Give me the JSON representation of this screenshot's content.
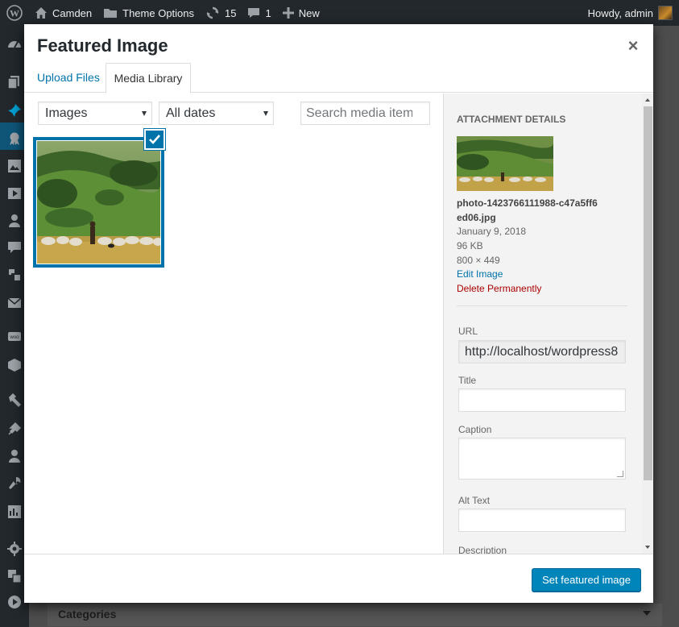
{
  "admin_bar": {
    "site_name": "Camden",
    "theme_options": "Theme Options",
    "updates_count": "15",
    "comments_count": "1",
    "new_label": "New",
    "greeting": "Howdy, admin"
  },
  "admin_menu": {
    "icons": [
      "dashboard-icon",
      "posts-icon",
      "pin-icon",
      "award-icon",
      "media-icon",
      "video-icon",
      "users-icon",
      "comments-icon",
      "tools-icon",
      "email-icon",
      "woo-icon",
      "box-icon",
      "hammer-icon",
      "plugins-icon",
      "person-icon",
      "wrench-icon",
      "grid-icon",
      "gear-icon",
      "translate-icon",
      "play-icon"
    ]
  },
  "modal": {
    "title": "Featured Image",
    "close_symbol": "×",
    "tabs": [
      {
        "label": "Upload Files",
        "active": false
      },
      {
        "label": "Media Library",
        "active": true
      }
    ],
    "filters": {
      "type_selected": "Images",
      "date_selected": "All dates",
      "search_placeholder": "Search media items..."
    },
    "attachments": [
      {
        "alt": "Shepherd with sheep on green hillside",
        "selected": true
      }
    ],
    "details": {
      "heading": "Attachment Details",
      "filename": "photo-1423766111988-c47a5ff6ed06.jpg",
      "date": "January 9, 2018",
      "size": "96 KB",
      "dimensions": "800 × 449",
      "edit_link": "Edit Image",
      "delete_link": "Delete Permanently",
      "fields": {
        "url_label": "URL",
        "url_value": "http://localhost/wordpress8",
        "title_label": "Title",
        "title_value": "",
        "caption_label": "Caption",
        "caption_value": "",
        "alt_label": "Alt Text",
        "alt_value": "",
        "description_label": "Description"
      }
    },
    "primary_button": "Set featured image"
  },
  "underlying": {
    "categories_label": "Categories"
  },
  "colors": {
    "accent": "#0073aa",
    "button": "#0085ba",
    "danger": "#a00",
    "admin_bar": "#23282d"
  }
}
